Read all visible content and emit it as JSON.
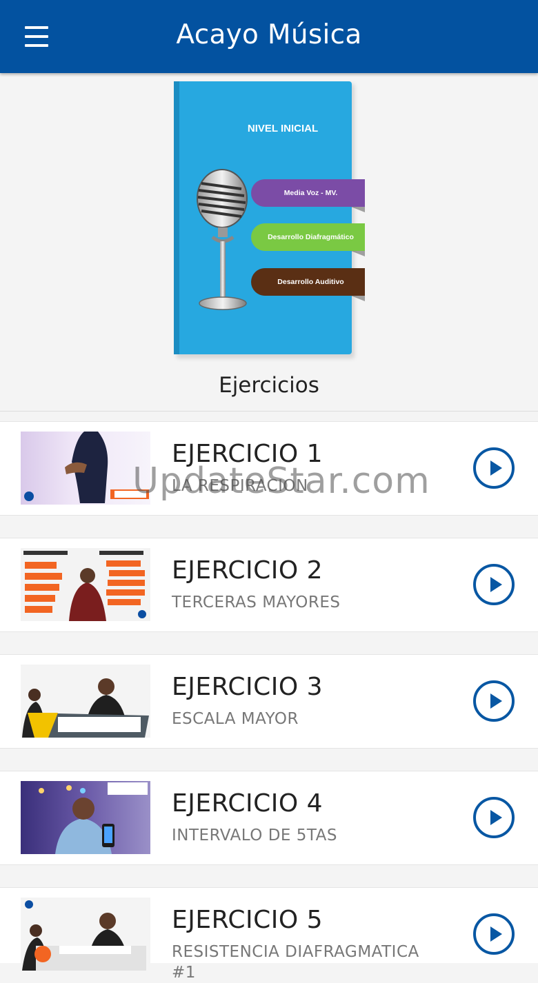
{
  "header": {
    "title": "Acayo Música"
  },
  "book": {
    "title": "NIVEL INICIAL",
    "tabs": [
      "Media Voz - MV.",
      "Desarrollo Diafragmático",
      "Desarrollo Auditivo"
    ],
    "colors": {
      "cover": "#27a8e0",
      "tab_purple": "#7b4ca6",
      "tab_green": "#7ac943",
      "tab_brown": "#5a2f14"
    }
  },
  "section": {
    "title": "Ejercicios"
  },
  "exercises": [
    {
      "title": "EJERCICIO 1",
      "subtitle": "LA RESPIRACION"
    },
    {
      "title": "EJERCICIO 2",
      "subtitle": "TERCERAS MAYORES"
    },
    {
      "title": "EJERCICIO 3",
      "subtitle": "ESCALA MAYOR"
    },
    {
      "title": "EJERCICIO 4",
      "subtitle": "INTERVALO DE 5TAS"
    },
    {
      "title": "EJERCICIO 5",
      "subtitle": "RESISTENCIA DIAFRAGMATICA #1"
    }
  ],
  "watermark": "UpdateStar.com",
  "colors": {
    "header": "#0352a0",
    "accent": "#0857a3"
  }
}
